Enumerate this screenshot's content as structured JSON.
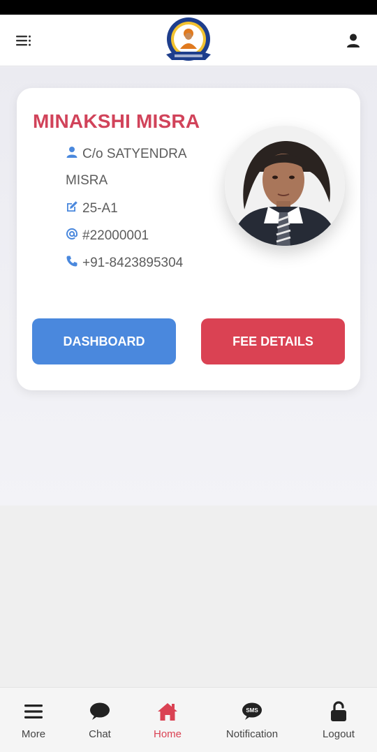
{
  "header": {
    "menu_icon": "menu-icon",
    "logo": "school-logo",
    "profile_icon": "user-icon"
  },
  "student": {
    "name": "MINAKSHI MISRA",
    "guardian_line1": "C/o SATYENDRA",
    "guardian_line2": "MISRA",
    "class_section": "25-A1",
    "admission_no": "#22000001",
    "phone": "+91-8423895304"
  },
  "actions": {
    "dashboard_label": "DASHBOARD",
    "fee_label": "FEE DETAILS"
  },
  "tabbar": {
    "items": [
      {
        "label": "More",
        "icon": "hamburger-icon"
      },
      {
        "label": "Chat",
        "icon": "chat-bubble-icon"
      },
      {
        "label": "Home",
        "icon": "home-icon",
        "active": true
      },
      {
        "label": "Notification",
        "icon": "sms-icon"
      },
      {
        "label": "Logout",
        "icon": "unlock-icon"
      }
    ]
  },
  "colors": {
    "accent_red": "#da4253",
    "accent_blue": "#4a88dd",
    "name_color": "#d1435a",
    "icon_blue": "#4a88dd"
  }
}
